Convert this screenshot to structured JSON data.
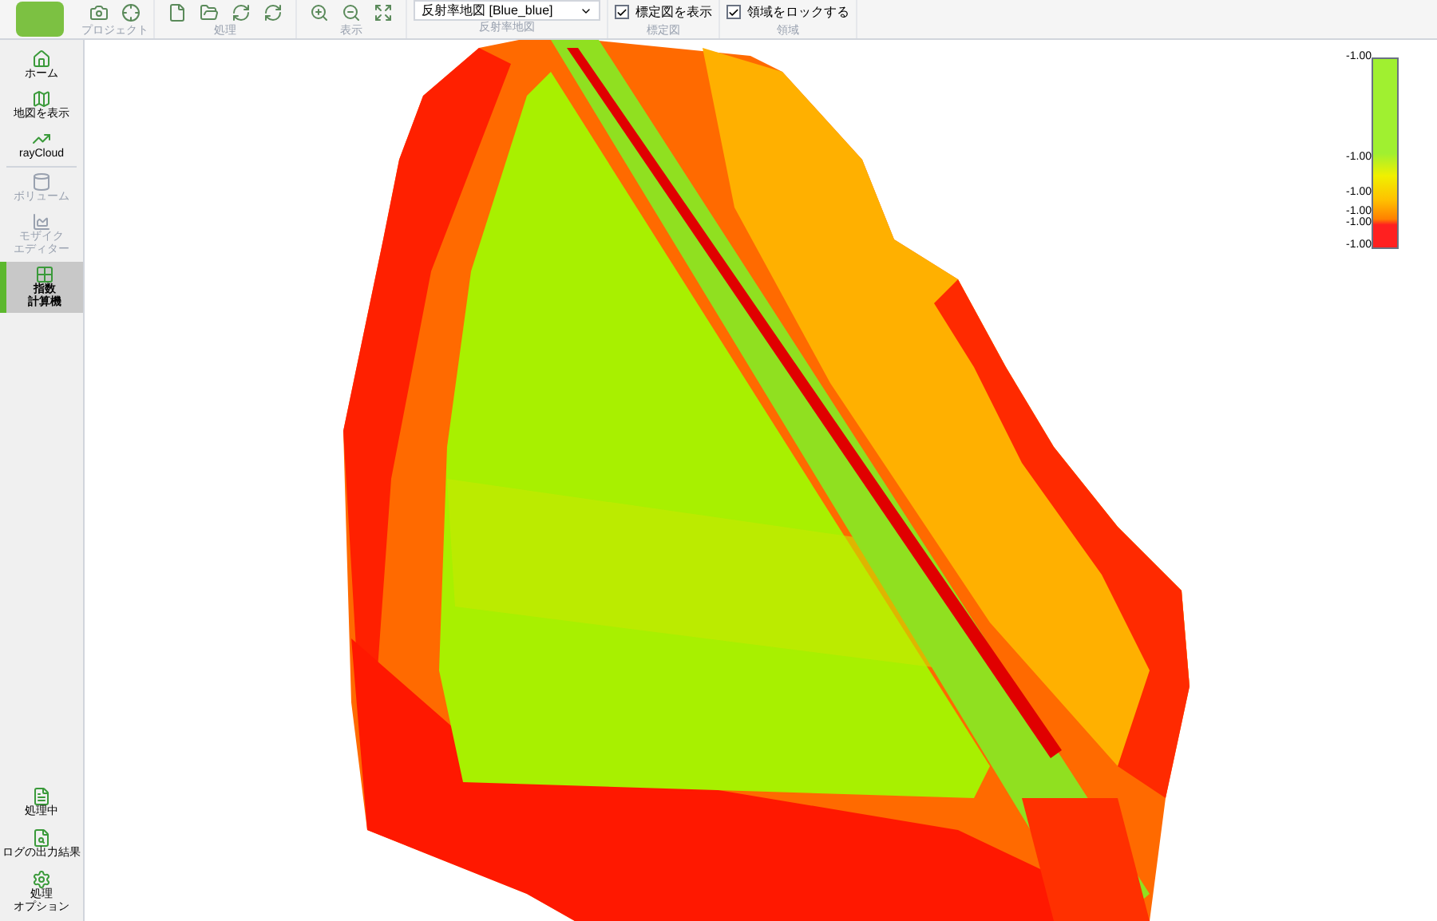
{
  "toolbar": {
    "groups": [
      {
        "label": "プロジェクト",
        "kind": "icons"
      },
      {
        "label": "処理",
        "kind": "icons"
      },
      {
        "label": "表示",
        "kind": "icons"
      },
      {
        "label": "反射率地図",
        "kind": "select",
        "value": "反射率地図 [Blue_blue]"
      },
      {
        "label": "標定図",
        "kind": "checkbox",
        "text": "標定図を表示",
        "checked": true
      },
      {
        "label": "領域",
        "kind": "checkbox",
        "text": "領域をロックする",
        "checked": true
      }
    ]
  },
  "sidebar": {
    "top": [
      {
        "label": "ホーム",
        "disabled": false,
        "selected": false
      },
      {
        "label": "地図を表示",
        "disabled": false,
        "selected": false
      },
      {
        "label": "rayCloud",
        "disabled": false,
        "selected": false
      },
      {
        "label": "ボリューム",
        "disabled": true,
        "selected": false
      },
      {
        "label": "モザイクエディター",
        "disabled": true,
        "selected": false
      },
      {
        "label": "指数計算機",
        "disabled": false,
        "selected": true
      }
    ],
    "bottom": [
      {
        "label": "処理中"
      },
      {
        "label": "ログの出力結果"
      },
      {
        "label": "処理オプション"
      }
    ]
  },
  "legend": {
    "ticks": [
      "-1.00",
      "-1.00",
      "-1.00",
      "-1.00",
      "-1.00",
      "-1.00"
    ]
  }
}
